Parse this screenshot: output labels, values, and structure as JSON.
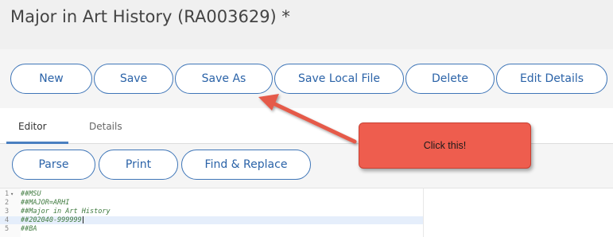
{
  "header": {
    "title": "Major in Art History (RA003629) *"
  },
  "toolbar": {
    "new_label": "New",
    "save_label": "Save",
    "save_as_label": "Save As",
    "save_local_label": "Save Local File",
    "delete_label": "Delete",
    "edit_details_label": "Edit Details"
  },
  "tabs": [
    {
      "label": "Editor",
      "active": true
    },
    {
      "label": "Details",
      "active": false
    }
  ],
  "editor_toolbar": {
    "parse_label": "Parse",
    "print_label": "Print",
    "find_replace_label": "Find & Replace"
  },
  "editor": {
    "lines": [
      {
        "number": "1",
        "text": "##MSU"
      },
      {
        "number": "2",
        "text": "##MAJOR=ARHI"
      },
      {
        "number": "3",
        "text": "##Major in Art History"
      },
      {
        "number": "4",
        "text": "##202040-999999"
      },
      {
        "number": "5",
        "text": "##BA"
      }
    ],
    "active_line": 4
  },
  "annotation": {
    "text": "Click this!"
  },
  "colors": {
    "accent": "#3f76b8",
    "callout": "#ee5d4e",
    "code_comment": "#3f7a3f"
  }
}
